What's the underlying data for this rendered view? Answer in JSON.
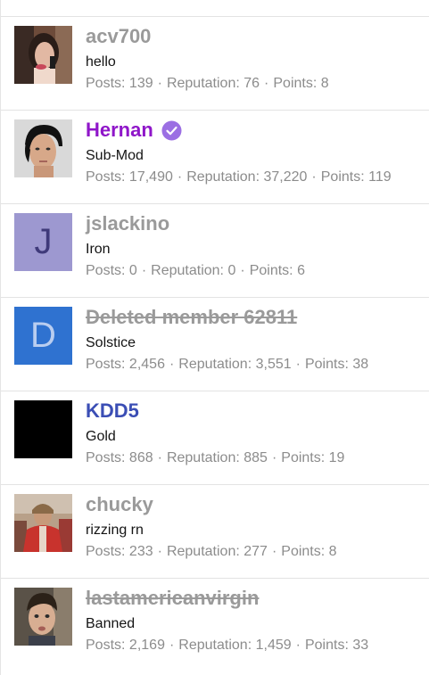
{
  "stat_labels": {
    "posts": "Posts:",
    "reputation": "Reputation:",
    "points": "Points:",
    "separator": "·"
  },
  "members": [
    {
      "username": "acv700",
      "title": "hello",
      "posts": "139",
      "reputation": "76",
      "points": "8",
      "name_color": "#9a9a9a",
      "struck": false,
      "verified": false,
      "avatar": {
        "kind": "photo",
        "icon": "woman-on-phone-photo"
      }
    },
    {
      "username": "Hernan",
      "title": "Sub-Mod",
      "posts": "17,490",
      "reputation": "37,220",
      "points": "119",
      "name_color": "#8f16c9",
      "struck": false,
      "verified": true,
      "verified_color": "#9b6fe3",
      "avatar": {
        "kind": "photo",
        "icon": "dark-haired-man-photo"
      }
    },
    {
      "username": "jslackino",
      "title": "Iron",
      "posts": "0",
      "reputation": "0",
      "points": "6",
      "name_color": "#9a9a9a",
      "struck": false,
      "verified": false,
      "avatar": {
        "kind": "letter",
        "letter": "J",
        "bg": "#9d98d0",
        "fg": "#3f3a7a"
      }
    },
    {
      "username": "Deleted member 62811",
      "title": "Solstice",
      "posts": "2,456",
      "reputation": "3,551",
      "points": "38",
      "name_color": "#9a9a9a",
      "struck": true,
      "verified": false,
      "avatar": {
        "kind": "letter",
        "letter": "D",
        "bg": "#2f72d0",
        "fg": "#b9cdf0"
      }
    },
    {
      "username": "KDD5",
      "title": "Gold",
      "posts": "868",
      "reputation": "885",
      "points": "19",
      "name_color": "#3b4eb5",
      "struck": false,
      "verified": false,
      "avatar": {
        "kind": "solid",
        "bg": "#000000",
        "icon": "black-square-avatar"
      }
    },
    {
      "username": "chucky",
      "title": "rizzing rn",
      "posts": "233",
      "reputation": "277",
      "points": "8",
      "name_color": "#9a9a9a",
      "struck": false,
      "verified": false,
      "avatar": {
        "kind": "photo",
        "icon": "man-in-red-outdoors-photo"
      }
    },
    {
      "username": "lastamericanvirgin",
      "title": "Banned",
      "posts": "2,169",
      "reputation": "1,459",
      "points": "33",
      "name_color": "#9a9a9a",
      "struck": true,
      "verified": false,
      "avatar": {
        "kind": "photo",
        "icon": "young-man-photo"
      }
    }
  ]
}
